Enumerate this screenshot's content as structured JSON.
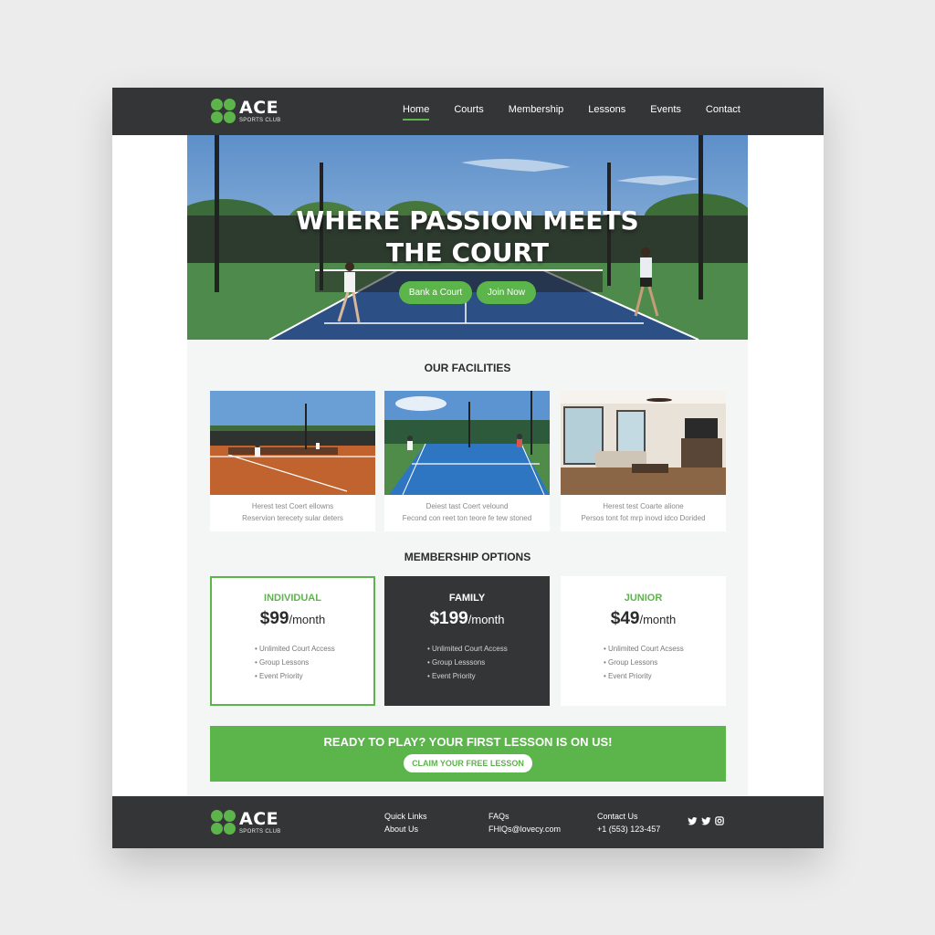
{
  "brand": {
    "name": "ACE",
    "tagline": "SPORTS CLUB",
    "accent_color": "#5cb54a",
    "dark_color": "#343536"
  },
  "nav": {
    "items": [
      {
        "label": "Home",
        "active": true
      },
      {
        "label": "Courts"
      },
      {
        "label": "Membership"
      },
      {
        "label": "Lessons"
      },
      {
        "label": "Events"
      },
      {
        "label": "Contact"
      }
    ]
  },
  "hero": {
    "title_line1": "WHERE PASSION MEETS",
    "title_line2": "THE COURT",
    "book_label": "Bank a Court",
    "join_label": "Join Now"
  },
  "facilities": {
    "title": "OUR FACILITIES",
    "items": [
      {
        "image": "clay-court-photo",
        "line1": "Herest test Coert ellowns",
        "line2": "Reservion terecety sular deters"
      },
      {
        "image": "hard-court-photo",
        "line1": "Deiest tast Coert velound",
        "line2": "Fecond con reet ton teore fe tew stoned"
      },
      {
        "image": "clubhouse-lounge-photo",
        "line1": "Herest test Coarte alione",
        "line2": "Persos tont fot mrp inovd idco Dorided"
      }
    ]
  },
  "membership": {
    "title": "MEMBERSHIP OPTIONS",
    "plans": [
      {
        "name": "INDIVIDUAL",
        "price": "$99",
        "period": "/month",
        "features": [
          "Unlimited Court Access",
          "Group Lessons",
          "Event Priority"
        ]
      },
      {
        "name": "FAMILY",
        "price": "$199",
        "period": "/month",
        "features": [
          "Unlimited Court Access",
          "Group Lesssons",
          "Event Priority"
        ]
      },
      {
        "name": "JUNIOR",
        "price": "$49",
        "period": "/month",
        "features": [
          "Unlimited Court Acsess",
          "Group Lessons",
          "Event Priority"
        ]
      }
    ]
  },
  "cta": {
    "title": "READY TO PLAY? YOUR FIRST LESSON IS ON US!",
    "button": "CLAIM YOUR FREE LESSON"
  },
  "footer": {
    "quick_links_title": "Quick Links",
    "quick_link": "About Us",
    "faqs_title": "FAQs",
    "email": "FHlQs@lovecy.com",
    "contact_title": "Contact Us",
    "phone": "+1 (553) 123-457",
    "social_icons": [
      "twitter-icon",
      "twitter-icon",
      "instagram-icon"
    ]
  }
}
